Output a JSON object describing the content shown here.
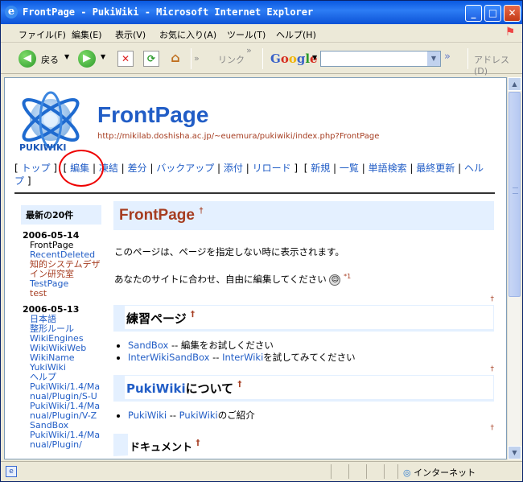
{
  "window": {
    "title": "FrontPage - PukiWiki - Microsoft Internet Explorer",
    "min": "_",
    "max": "□",
    "close": "✕"
  },
  "menubar": {
    "items": [
      "ファイル(F)",
      "編集(E)",
      "表示(V)",
      "お気に入り(A)",
      "ツール(T)",
      "ヘルプ(H)"
    ]
  },
  "toolbar": {
    "back_label": "戻る",
    "links_label": "リンク",
    "google_label": "Google",
    "address_label": "アドレス(D)"
  },
  "page": {
    "title": "FrontPage",
    "url": "http://mikilab.doshisha.ac.jp/~euemura/pukiwiki/index.php?FrontPage",
    "logo_text": "PUKIWIKI",
    "nav": {
      "group1": [
        "トップ"
      ],
      "group2": [
        "編集",
        "凍結",
        "差分",
        "バックアップ",
        "添付",
        "リロード"
      ],
      "group3": [
        "新規",
        "一覧",
        "単語検索",
        "最終更新",
        "ヘルプ"
      ]
    },
    "menubar_title": "最新の20件",
    "recent": [
      {
        "date": "2006-05-14",
        "items": [
          {
            "label": "FrontPage",
            "state": "cur"
          },
          {
            "label": "RecentDeleted",
            "state": "link"
          },
          {
            "label": "知的システムデザイン研究室",
            "state": "vis"
          },
          {
            "label": "TestPage",
            "state": "link"
          },
          {
            "label": "test",
            "state": "vis"
          }
        ]
      },
      {
        "date": "2006-05-13",
        "items": [
          {
            "label": "日本語",
            "state": "link"
          },
          {
            "label": "整形ルール",
            "state": "link"
          },
          {
            "label": "WikiEngines",
            "state": "link"
          },
          {
            "label": "WikiWikiWeb",
            "state": "link"
          },
          {
            "label": "WikiName",
            "state": "link"
          },
          {
            "label": "YukiWiki",
            "state": "link"
          },
          {
            "label": "ヘルプ",
            "state": "link"
          },
          {
            "label": "PukiWiki/1.4/Manual/Plugin/S-U",
            "state": "link"
          },
          {
            "label": "PukiWiki/1.4/Manual/Plugin/V-Z",
            "state": "link"
          },
          {
            "label": "SandBox",
            "state": "link"
          },
          {
            "label": "PukiWiki/1.4/Manual/Plugin/",
            "state": "link"
          }
        ]
      }
    ],
    "heading": "FrontPage",
    "heading_mark": "†",
    "para1": "このページは、ページを指定しない時に表示されます。",
    "para2": "あなたのサイトに合わせ、自由に編集してください",
    "footnote": "*1",
    "anchor": "†",
    "section1": {
      "title": "練習ページ",
      "items": [
        {
          "link": "SandBox",
          "text": " -- 編集をお試しください"
        },
        {
          "link": "InterWikiSandBox",
          "text": " -- ",
          "link2": "InterWiki",
          "text2": "を試してみてください"
        }
      ]
    },
    "section2": {
      "title_link": "PukiWiki",
      "title_text": "について",
      "items": [
        {
          "link": "PukiWiki",
          "text": " -- ",
          "link2": "PukiWiki",
          "text2": "のご紹介"
        }
      ]
    },
    "section3": {
      "title": "ドキュメント"
    }
  },
  "status": {
    "zone": "インターネット"
  },
  "colors": {
    "link": "#215dc6",
    "visited": "#a63d21",
    "heading_bg": "#e4f0ff",
    "annotation": "#ee0000"
  }
}
